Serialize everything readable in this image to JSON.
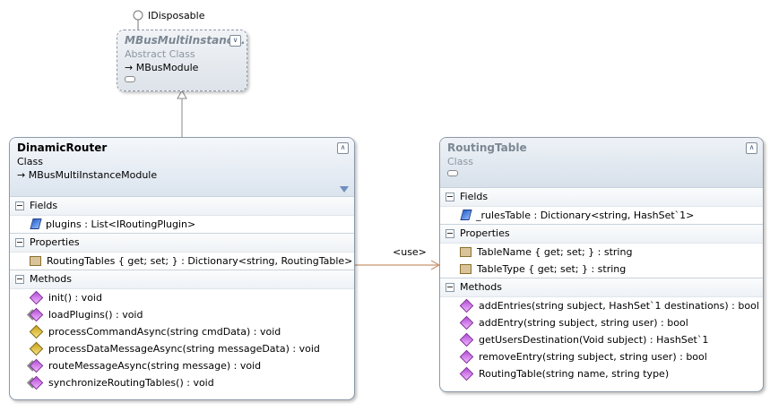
{
  "interface_name": "IDisposable",
  "abstract_class": {
    "name": "MBusMultiInstanc...",
    "kind": "Abstract Class",
    "base": "→ MBusModule"
  },
  "dinamic_router": {
    "name": "DinamicRouter",
    "kind": "Class",
    "base": "→ MBusMultiInstanceModule",
    "fields_label": "Fields",
    "fields": [
      "plugins : List<IRoutingPlugin>"
    ],
    "properties_label": "Properties",
    "properties": [
      "RoutingTables { get; set; } : Dictionary<string, RoutingTable>"
    ],
    "methods_label": "Methods",
    "methods": [
      "init() : void",
      "loadPlugins() : void",
      "processCommandAsync(string cmdData) : void",
      "processDataMessageAsync(string messageData) : void",
      "routeMessageAsync(string message) : void",
      "synchronizeRoutingTables() : void"
    ]
  },
  "routing_table": {
    "name": "RoutingTable",
    "kind": "Class",
    "fields_label": "Fields",
    "fields": [
      "_rulesTable : Dictionary<string, HashSet`1>"
    ],
    "properties_label": "Properties",
    "properties": [
      "TableName { get; set; } : string",
      "TableType { get; set; } : string"
    ],
    "methods_label": "Methods",
    "methods": [
      "addEntries(string subject, HashSet`1 destinations) : bool",
      "addEntry(string subject, string user) : bool",
      "getUsersDestination(Void subject) : HashSet`1",
      "removeEntry(string subject, string user) : bool",
      "RoutingTable(string name, string type)"
    ]
  },
  "association_label": "<use>",
  "colors": {
    "connector": "#8a8a8a",
    "association": "#c8946e",
    "header_top": "#f4f7fb",
    "header_bottom": "#dbe4ee"
  }
}
